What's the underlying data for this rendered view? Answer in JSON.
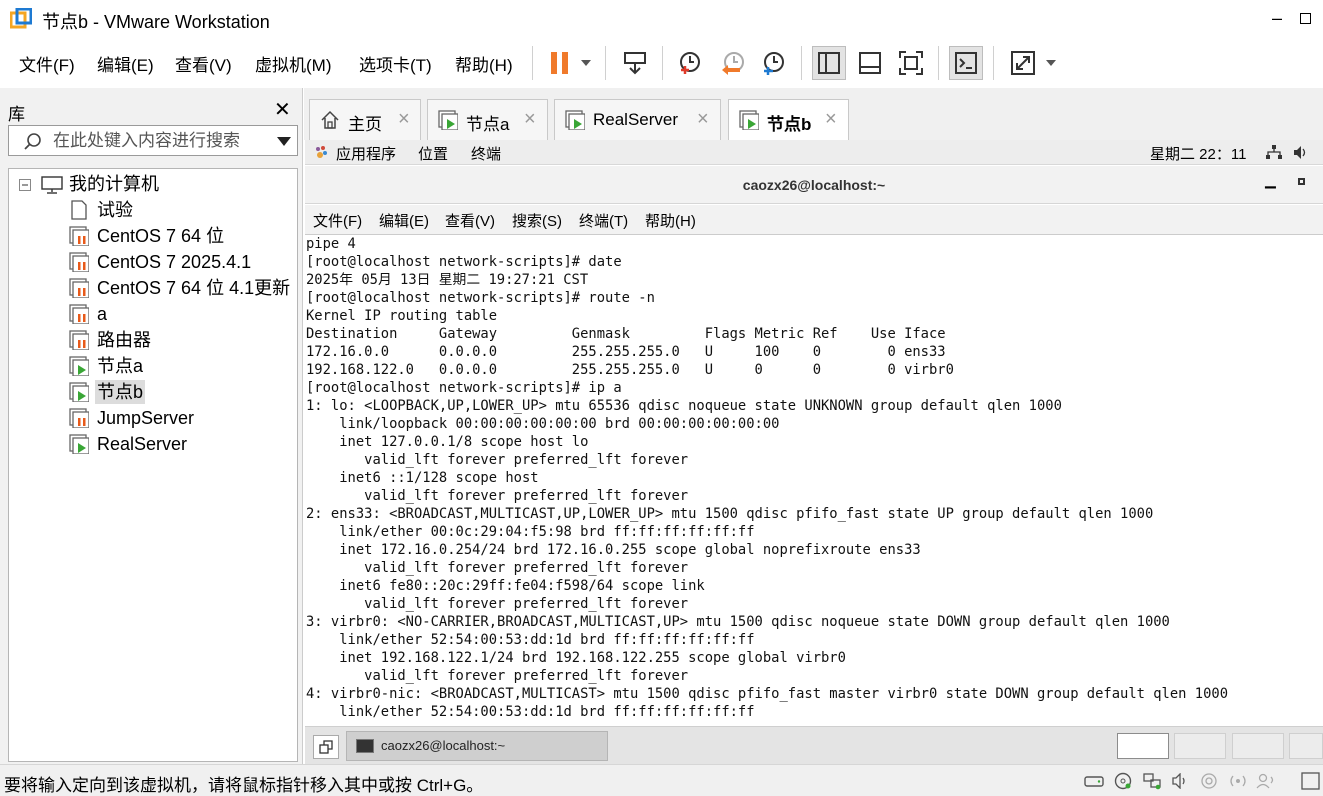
{
  "window": {
    "title": "节点b - VMware Workstation",
    "minimize_glyph": "–"
  },
  "menu": [
    "文件(F)",
    "编辑(E)",
    "查看(V)",
    "虚拟机(M)",
    "选项卡(T)",
    "帮助(H)"
  ],
  "library": {
    "title": "库",
    "close_glyph": "✕",
    "search_placeholder": "在此处键入内容进行搜索",
    "tree": [
      {
        "label": "我的计算机",
        "type": "root"
      },
      {
        "label": "试验",
        "type": "doc"
      },
      {
        "label": "CentOS 7 64 位",
        "type": "vm-off"
      },
      {
        "label": "CentOS 7 2025.4.1",
        "type": "vm-off"
      },
      {
        "label": "CentOS 7 64 位 4.1更新",
        "type": "vm-off"
      },
      {
        "label": "a",
        "type": "vm-off"
      },
      {
        "label": "路由器",
        "type": "vm-off"
      },
      {
        "label": "节点a",
        "type": "vm-on"
      },
      {
        "label": "节点b",
        "type": "vm-on",
        "selected": true
      },
      {
        "label": "JumpServer",
        "type": "vm-off"
      },
      {
        "label": "RealServer",
        "type": "vm-on"
      }
    ]
  },
  "tabs": [
    {
      "label": "主页",
      "type": "home"
    },
    {
      "label": "节点a",
      "type": "vm"
    },
    {
      "label": "RealServer",
      "type": "vm"
    },
    {
      "label": "节点b",
      "type": "vm",
      "active": true
    }
  ],
  "guest": {
    "gnome": {
      "apps": "应用程序",
      "places": "位置",
      "terminal": "终端",
      "clock": "星期二 22：11"
    },
    "terminal": {
      "title": "caozx26@localhost:~",
      "menu": [
        "文件(F)",
        "编辑(E)",
        "查看(V)",
        "搜索(S)",
        "终端(T)",
        "帮助(H)"
      ],
      "lines": [
        "pipe 4",
        "[root@localhost network-scripts]# date",
        "2025年 05月 13日 星期二 19:27:21 CST",
        "[root@localhost network-scripts]# route -n",
        "Kernel IP routing table",
        "Destination     Gateway         Genmask         Flags Metric Ref    Use Iface",
        "172.16.0.0      0.0.0.0         255.255.255.0   U     100    0        0 ens33",
        "192.168.122.0   0.0.0.0         255.255.255.0   U     0      0        0 virbr0",
        "[root@localhost network-scripts]# ip a",
        "1: lo: <LOOPBACK,UP,LOWER_UP> mtu 65536 qdisc noqueue state UNKNOWN group default qlen 1000",
        "    link/loopback 00:00:00:00:00:00 brd 00:00:00:00:00:00",
        "    inet 127.0.0.1/8 scope host lo",
        "       valid_lft forever preferred_lft forever",
        "    inet6 ::1/128 scope host",
        "       valid_lft forever preferred_lft forever",
        "2: ens33: <BROADCAST,MULTICAST,UP,LOWER_UP> mtu 1500 qdisc pfifo_fast state UP group default qlen 1000",
        "    link/ether 00:0c:29:04:f5:98 brd ff:ff:ff:ff:ff:ff",
        "    inet 172.16.0.254/24 brd 172.16.0.255 scope global noprefixroute ens33",
        "       valid_lft forever preferred_lft forever",
        "    inet6 fe80::20c:29ff:fe04:f598/64 scope link",
        "       valid_lft forever preferred_lft forever",
        "3: virbr0: <NO-CARRIER,BROADCAST,MULTICAST,UP> mtu 1500 qdisc noqueue state DOWN group default qlen 1000",
        "    link/ether 52:54:00:53:dd:1d brd ff:ff:ff:ff:ff:ff",
        "    inet 192.168.122.1/24 brd 192.168.122.255 scope global virbr0",
        "       valid_lft forever preferred_lft forever",
        "4: virbr0-nic: <BROADCAST,MULTICAST> mtu 1500 qdisc pfifo_fast master virbr0 state DOWN group default qlen 1000",
        "    link/ether 52:54:00:53:dd:1d brd ff:ff:ff:ff:ff:ff"
      ]
    },
    "taskbar_item": "caozx26@localhost:~"
  },
  "status": {
    "message": "要将输入定向到该虚拟机，请将鼠标指针移入其中或按 Ctrl+G。"
  },
  "colors": {
    "suspend": "#f07a2b",
    "vm_play": "#3aa636",
    "vm_off": "#e85a1a",
    "brand_blue": "#1e7ad2",
    "brand_orange": "#f5a623"
  }
}
